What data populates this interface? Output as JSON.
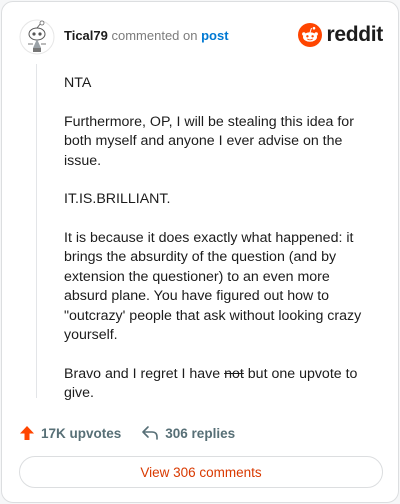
{
  "comment": {
    "username": "Tical79",
    "commented_on": "commented on",
    "post_link": "post",
    "paragraphs": {
      "p1": "NTA",
      "p2": "Furthermore, OP, I will be stealing this idea for both myself and anyone I ever advise on the issue.",
      "p3": "IT.IS.BRILLIANT.",
      "p4": "It is because it does exactly what happened: it brings the absurdity of the question (and by extension the questioner) to an even more absurd plane. You have figured out how to \"outcrazy' people that ask without looking crazy yourself.",
      "p5_before": "Bravo and I regret I have ",
      "p5_strike": "not",
      "p5_after": " but one upvote to give."
    }
  },
  "brand": {
    "name": "reddit",
    "icon": "reddit-logo-icon",
    "color": "#ff4500"
  },
  "actions": {
    "upvotes": "17K upvotes",
    "upvote_icon": "upvote-arrow-icon",
    "replies": "306 replies",
    "reply_icon": "reply-arrow-icon"
  },
  "view_comments": "View 306 comments",
  "colors": {
    "accent_orange": "#d93900",
    "link_blue": "#0079d3",
    "muted": "#576f76"
  }
}
